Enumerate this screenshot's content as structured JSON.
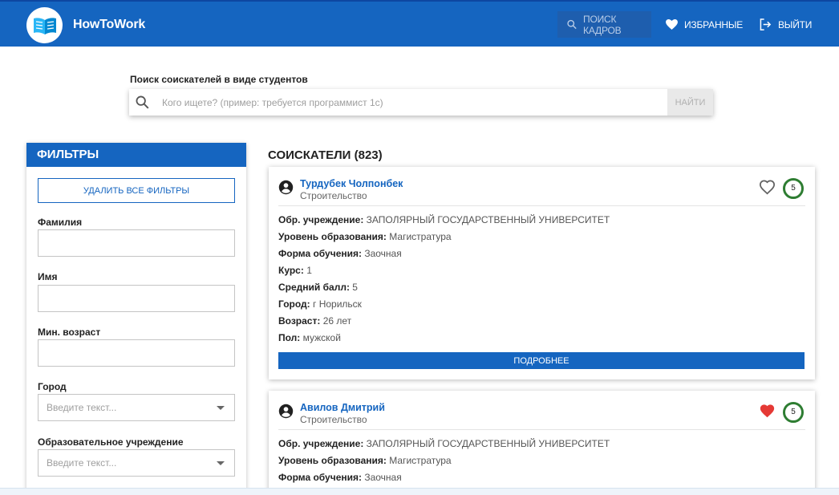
{
  "header": {
    "brand": "HowToWork",
    "nav": {
      "search": "ПОИСК КАДРОВ",
      "favorites": "ИЗБРАННЫЕ",
      "exit": "ВЫЙТИ"
    },
    "colors": {
      "primary": "#1565c0"
    }
  },
  "search": {
    "label": "Поиск соискателей в виде студентов",
    "placeholder": "Кого ищете? (пример: требуется программист 1с)",
    "value": "",
    "button": "НАЙТИ"
  },
  "filters": {
    "title": "ФИЛЬТРЫ",
    "clear_button": "УДАЛИТЬ ВСЕ ФИЛЬТРЫ",
    "fields": [
      {
        "label": "Фамилия",
        "value": ""
      },
      {
        "label": "Имя",
        "value": ""
      },
      {
        "label": "Мин. возраст",
        "value": ""
      }
    ],
    "selects": [
      {
        "label": "Город",
        "placeholder": "Введите текст..."
      },
      {
        "label": "Образовательное учреждение",
        "placeholder": "Введите текст..."
      }
    ]
  },
  "results": {
    "title": "СОИСКАТЕЛИ (823)",
    "cards": [
      {
        "name": "Турдубек Чолпонбек",
        "specialty": "Строительство",
        "favorite": false,
        "rating": "5",
        "fields": [
          {
            "label": "Обр. учреждение:",
            "value": "ЗАПОЛЯРНЫЙ ГОСУДАРСТВЕННЫЙ УНИВЕРСИТЕТ"
          },
          {
            "label": "Уровень образования:",
            "value": "Магистратура"
          },
          {
            "label": "Форма обучения:",
            "value": "Заочная"
          },
          {
            "label": "Курс:",
            "value": "1"
          },
          {
            "label": "Средний балл:",
            "value": "5"
          },
          {
            "label": "Город:",
            "value": "г Норильск"
          },
          {
            "label": "Возраст:",
            "value": "26 лет"
          },
          {
            "label": "Пол:",
            "value": "мужской"
          }
        ],
        "details_button": "ПОДРОБНЕЕ"
      },
      {
        "name": "Авилов Дмитрий",
        "specialty": "Строительство",
        "favorite": true,
        "rating": "5",
        "fields": [
          {
            "label": "Обр. учреждение:",
            "value": "ЗАПОЛЯРНЫЙ ГОСУДАРСТВЕННЫЙ УНИВЕРСИТЕТ"
          },
          {
            "label": "Уровень образования:",
            "value": "Магистратура"
          },
          {
            "label": "Форма обучения:",
            "value": "Заочная"
          }
        ]
      }
    ],
    "colors": {
      "favorite_active": "#e53935",
      "rating_ring": "#2e7d32"
    }
  }
}
